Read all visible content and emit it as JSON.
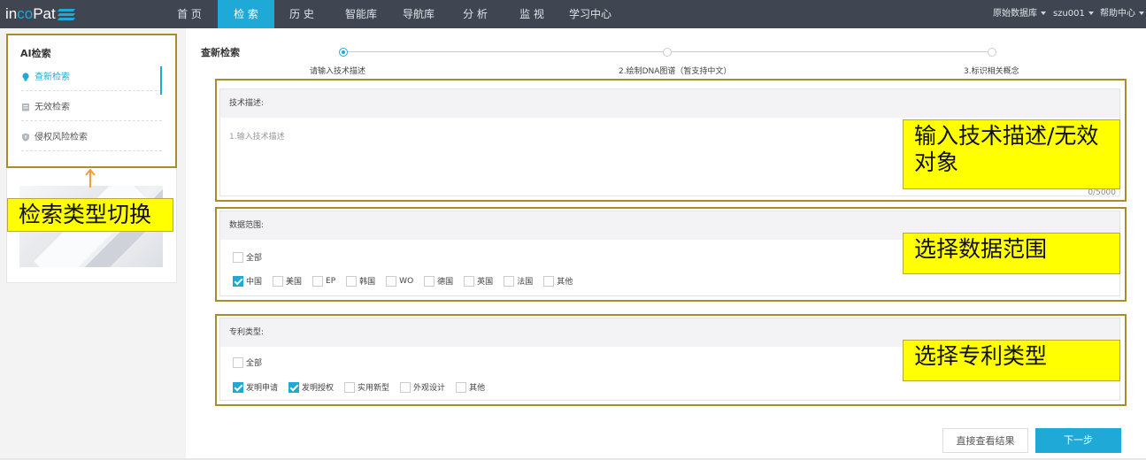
{
  "app": {
    "logo_prefix": "in",
    "logo_mid": "co",
    "logo_suffix": "Pat"
  },
  "nav": {
    "items": [
      {
        "label": "首 页"
      },
      {
        "label": "检 索"
      },
      {
        "label": "历 史"
      },
      {
        "label": "智能库"
      },
      {
        "label": "导航库"
      },
      {
        "label": "分 析"
      },
      {
        "label": "监 视"
      },
      {
        "label": "学习中心"
      }
    ],
    "active_index": 1,
    "right": {
      "database": "原始数据库",
      "user": "szu001",
      "help": "帮助中心"
    }
  },
  "sidebar": {
    "title": "AI检索",
    "items": [
      {
        "label": "查新检索",
        "icon": "bulb-icon",
        "active": true
      },
      {
        "label": "无效检索",
        "icon": "document-icon",
        "active": false
      },
      {
        "label": "侵权风险检索",
        "icon": "shield-icon",
        "active": false
      }
    ]
  },
  "main": {
    "title": "查新检索",
    "steps": [
      {
        "label": "请输入技术描述",
        "active": true
      },
      {
        "label": "2.绘制DNA图谱（暂支持中文）",
        "active": false
      },
      {
        "label": "3.标识相关概念",
        "active": false
      }
    ],
    "tech": {
      "header": "技术描述:",
      "placeholder": "1.输入技术描述",
      "counter": "0/5000"
    },
    "scope": {
      "header": "数据范围:",
      "all_label": "全部",
      "all_checked": false,
      "options": [
        {
          "label": "中国",
          "checked": true
        },
        {
          "label": "美国",
          "checked": false
        },
        {
          "label": "EP",
          "checked": false
        },
        {
          "label": "韩国",
          "checked": false
        },
        {
          "label": "WO",
          "checked": false
        },
        {
          "label": "德国",
          "checked": false
        },
        {
          "label": "英国",
          "checked": false
        },
        {
          "label": "法国",
          "checked": false
        },
        {
          "label": "其他",
          "checked": false
        }
      ]
    },
    "patent_type": {
      "header": "专利类型:",
      "all_label": "全部",
      "all_checked": false,
      "options": [
        {
          "label": "发明申请",
          "checked": true
        },
        {
          "label": "发明授权",
          "checked": true
        },
        {
          "label": "实用新型",
          "checked": false
        },
        {
          "label": "外观设计",
          "checked": false
        },
        {
          "label": "其他",
          "checked": false
        }
      ]
    },
    "buttons": {
      "view_results": "直接查看结果",
      "next": "下一步"
    }
  },
  "annotations": {
    "search_type": "检索类型切换",
    "tech_desc": "输入技术描述/无效对象",
    "scope": "选择数据范围",
    "patent_type": "选择专利类型"
  },
  "colors": {
    "nav_bg": "#3f4651",
    "accent": "#1fa9d6",
    "callout_bg": "#ffff00",
    "frame": "#a88c2e"
  }
}
